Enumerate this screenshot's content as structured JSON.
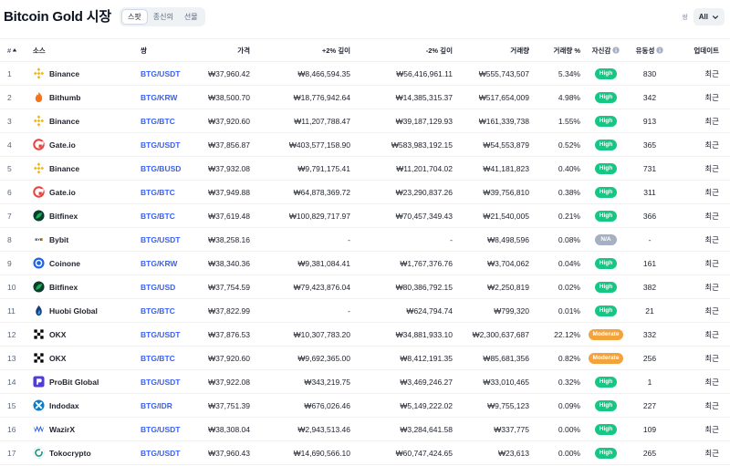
{
  "page": {
    "title": "Bitcoin Gold 시장",
    "tabs": [
      {
        "label": "스팟",
        "active": true
      },
      {
        "label": "종신의",
        "active": false
      },
      {
        "label": "선물",
        "active": false
      }
    ],
    "filter_label": "쌍",
    "filter_value": "All"
  },
  "columns": {
    "num": "#",
    "source": "소스",
    "pair": "쌍",
    "price": "가격",
    "depth_plus": "+2% 깊이",
    "depth_minus": "-2% 깊이",
    "volume": "거래량",
    "volume_pct": "거래량 %",
    "confidence": "자신감",
    "liquidity": "유동성",
    "updated": "업데이트"
  },
  "colors": {
    "high": "#16c784",
    "moderate": "#f3a33b",
    "na": "#a6b0c3",
    "pair_link": "#3861fb"
  },
  "rows": [
    {
      "num": "1",
      "exchange": "Binance",
      "logo": "binance-icon",
      "pair": "BTG/USDT",
      "price": "₩37,960.42",
      "plus": "₩8,466,594.35",
      "minus": "₩56,416,961.11",
      "volume": "₩555,743,507",
      "vol_pct": "5.34%",
      "confidence": "High",
      "conf_type": "high",
      "liquidity": "830",
      "updated": "최근"
    },
    {
      "num": "2",
      "exchange": "Bithumb",
      "logo": "bithumb-icon",
      "pair": "BTG/KRW",
      "price": "₩38,500.70",
      "plus": "₩18,776,942.64",
      "minus": "₩14,385,315.37",
      "volume": "₩517,654,009",
      "vol_pct": "4.98%",
      "confidence": "High",
      "conf_type": "high",
      "liquidity": "342",
      "updated": "최근"
    },
    {
      "num": "3",
      "exchange": "Binance",
      "logo": "binance-icon",
      "pair": "BTG/BTC",
      "price": "₩37,920.60",
      "plus": "₩11,207,788.47",
      "minus": "₩39,187,129.93",
      "volume": "₩161,339,738",
      "vol_pct": "1.55%",
      "confidence": "High",
      "conf_type": "high",
      "liquidity": "913",
      "updated": "최근"
    },
    {
      "num": "4",
      "exchange": "Gate.io",
      "logo": "gateio-icon",
      "pair": "BTG/USDT",
      "price": "₩37,856.87",
      "plus": "₩403,577,158.90",
      "minus": "₩583,983,192.15",
      "volume": "₩54,553,879",
      "vol_pct": "0.52%",
      "confidence": "High",
      "conf_type": "high",
      "liquidity": "365",
      "updated": "최근"
    },
    {
      "num": "5",
      "exchange": "Binance",
      "logo": "binance-icon",
      "pair": "BTG/BUSD",
      "price": "₩37,932.08",
      "plus": "₩9,791,175.41",
      "minus": "₩11,201,704.02",
      "volume": "₩41,181,823",
      "vol_pct": "0.40%",
      "confidence": "High",
      "conf_type": "high",
      "liquidity": "731",
      "updated": "최근"
    },
    {
      "num": "6",
      "exchange": "Gate.io",
      "logo": "gateio-icon",
      "pair": "BTG/BTC",
      "price": "₩37,949.88",
      "plus": "₩64,878,369.72",
      "minus": "₩23,290,837.26",
      "volume": "₩39,756,810",
      "vol_pct": "0.38%",
      "confidence": "High",
      "conf_type": "high",
      "liquidity": "311",
      "updated": "최근"
    },
    {
      "num": "7",
      "exchange": "Bitfinex",
      "logo": "bitfinex-icon",
      "pair": "BTG/BTC",
      "price": "₩37,619.48",
      "plus": "₩100,829,717.97",
      "minus": "₩70,457,349.43",
      "volume": "₩21,540,005",
      "vol_pct": "0.21%",
      "confidence": "High",
      "conf_type": "high",
      "liquidity": "366",
      "updated": "최근"
    },
    {
      "num": "8",
      "exchange": "Bybit",
      "logo": "bybit-icon",
      "pair": "BTG/USDT",
      "price": "₩38,258.16",
      "plus": "-",
      "minus": "-",
      "volume": "₩8,498,596",
      "vol_pct": "0.08%",
      "confidence": "N/A",
      "conf_type": "na",
      "liquidity": "-",
      "updated": "최근"
    },
    {
      "num": "9",
      "exchange": "Coinone",
      "logo": "coinone-icon",
      "pair": "BTG/KRW",
      "price": "₩38,340.36",
      "plus": "₩9,381,084.41",
      "minus": "₩1,767,376.76",
      "volume": "₩3,704,062",
      "vol_pct": "0.04%",
      "confidence": "High",
      "conf_type": "high",
      "liquidity": "161",
      "updated": "최근"
    },
    {
      "num": "10",
      "exchange": "Bitfinex",
      "logo": "bitfinex-icon",
      "pair": "BTG/USD",
      "price": "₩37,754.59",
      "plus": "₩79,423,876.04",
      "minus": "₩80,386,792.15",
      "volume": "₩2,250,819",
      "vol_pct": "0.02%",
      "confidence": "High",
      "conf_type": "high",
      "liquidity": "382",
      "updated": "최근"
    },
    {
      "num": "11",
      "exchange": "Huobi Global",
      "logo": "huobi-icon",
      "pair": "BTG/BTC",
      "price": "₩37,822.99",
      "plus": "-",
      "minus": "₩624,794.74",
      "volume": "₩799,320",
      "vol_pct": "0.01%",
      "confidence": "High",
      "conf_type": "high",
      "liquidity": "21",
      "updated": "최근"
    },
    {
      "num": "12",
      "exchange": "OKX",
      "logo": "okx-icon",
      "pair": "BTG/USDT",
      "price": "₩37,876.53",
      "plus": "₩10,307,783.20",
      "minus": "₩34,881,933.10",
      "volume": "₩2,300,637,687",
      "vol_pct": "22.12%",
      "confidence": "Moderate",
      "conf_type": "mod",
      "liquidity": "332",
      "updated": "최근"
    },
    {
      "num": "13",
      "exchange": "OKX",
      "logo": "okx-icon",
      "pair": "BTG/BTC",
      "price": "₩37,920.60",
      "plus": "₩9,692,365.00",
      "minus": "₩8,412,191.35",
      "volume": "₩85,681,356",
      "vol_pct": "0.82%",
      "confidence": "Moderate",
      "conf_type": "mod",
      "liquidity": "256",
      "updated": "최근"
    },
    {
      "num": "14",
      "exchange": "ProBit Global",
      "logo": "probit-icon",
      "pair": "BTG/USDT",
      "price": "₩37,922.08",
      "plus": "₩343,219.75",
      "minus": "₩3,469,246.27",
      "volume": "₩33,010,465",
      "vol_pct": "0.32%",
      "confidence": "High",
      "conf_type": "high",
      "liquidity": "1",
      "updated": "최근"
    },
    {
      "num": "15",
      "exchange": "Indodax",
      "logo": "indodax-icon",
      "pair": "BTG/IDR",
      "price": "₩37,751.39",
      "plus": "₩676,026.46",
      "minus": "₩5,149,222.02",
      "volume": "₩9,755,123",
      "vol_pct": "0.09%",
      "confidence": "High",
      "conf_type": "high",
      "liquidity": "227",
      "updated": "최근"
    },
    {
      "num": "16",
      "exchange": "WazirX",
      "logo": "wazirx-icon",
      "pair": "BTG/USDT",
      "price": "₩38,308.04",
      "plus": "₩2,943,513.46",
      "minus": "₩3,284,641.58",
      "volume": "₩337,775",
      "vol_pct": "0.00%",
      "confidence": "High",
      "conf_type": "high",
      "liquidity": "109",
      "updated": "최근"
    },
    {
      "num": "17",
      "exchange": "Tokocrypto",
      "logo": "tokocrypto-icon",
      "pair": "BTG/USDT",
      "price": "₩37,960.43",
      "plus": "₩14,690,566.10",
      "minus": "₩60,747,424.65",
      "volume": "₩23,613",
      "vol_pct": "0.00%",
      "confidence": "High",
      "conf_type": "high",
      "liquidity": "265",
      "updated": "최근"
    }
  ]
}
